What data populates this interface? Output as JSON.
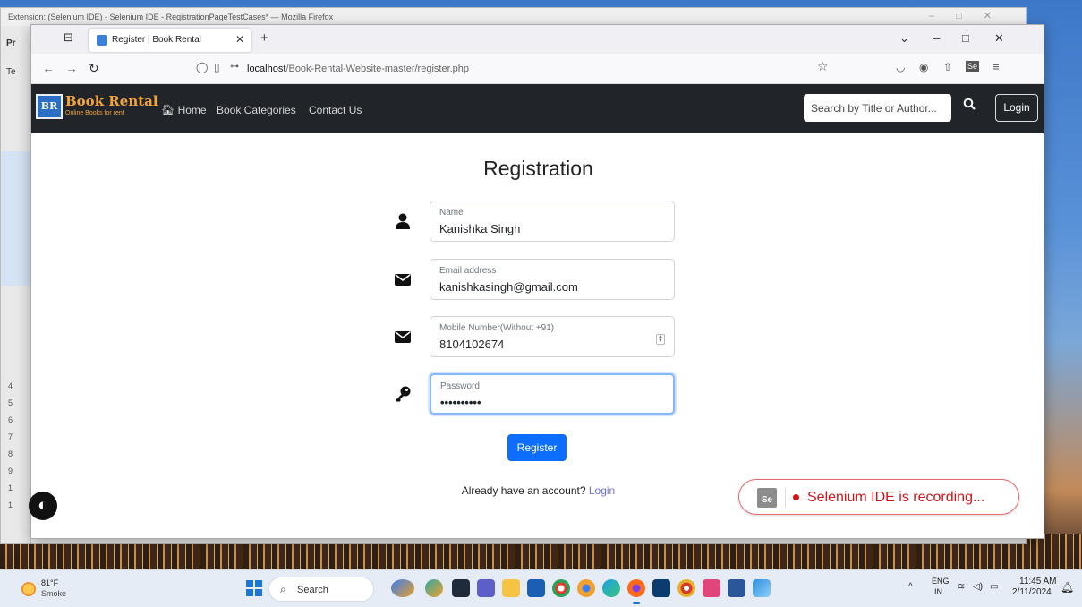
{
  "background_window": {
    "title": "Extension: (Selenium IDE) - Selenium IDE - RegistrationPageTestCases* — Mozilla Firefox",
    "strip_labels": [
      "Pr",
      "Te"
    ],
    "line_numbers": [
      "4",
      "5",
      "6",
      "7",
      "8",
      "9",
      "1",
      "1"
    ]
  },
  "browser": {
    "tab_title": "Register | Book Rental",
    "url_host": "localhost",
    "url_path": "/Book-Rental-Website-master/register.php"
  },
  "site": {
    "logo_text": "BR",
    "brand_name": "Book Rental",
    "brand_tagline": "Online Books for rent",
    "nav": {
      "home": "Home",
      "categories": "Book Categories",
      "contact": "Contact Us"
    },
    "search_placeholder": "Search by Title or Author...",
    "login": "Login"
  },
  "form": {
    "title": "Registration",
    "name": {
      "label": "Name",
      "value": "Kanishka Singh"
    },
    "email": {
      "label": "Email address",
      "value": "kanishkasingh@gmail.com"
    },
    "mobile": {
      "label": "Mobile Number(Without +91)",
      "value": "8104102674"
    },
    "password": {
      "label": "Password",
      "value": "••••••••••"
    },
    "register": "Register",
    "already_text": "Already have an account?",
    "login_link": "Login"
  },
  "selenium": {
    "badge": "Se",
    "status": "Selenium IDE is recording..."
  },
  "taskbar": {
    "temperature": "81°F",
    "condition": "Smoke",
    "search": "Search",
    "lang_top": "ENG",
    "lang_bottom": "IN",
    "time": "11:45 AM",
    "date": "2/11/2024"
  },
  "colors": {
    "navbar": "#212529",
    "brand": "#f3a53a",
    "primary": "#0d6efd",
    "recording": "#d0141a"
  }
}
